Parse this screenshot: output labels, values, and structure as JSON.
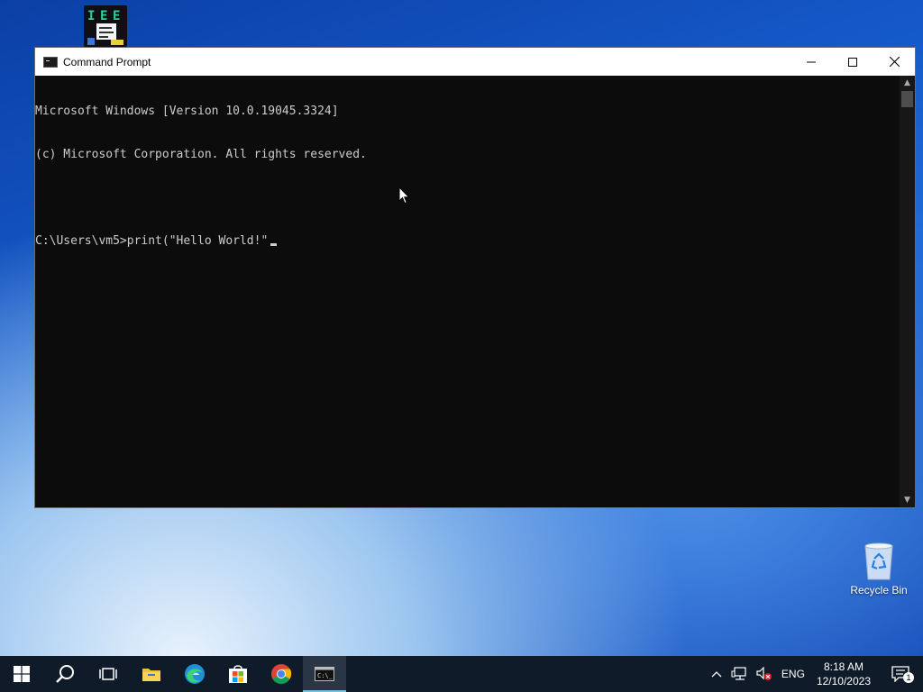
{
  "desktop": {
    "icons": [
      {
        "label": ""
      },
      {
        "label": "Recycle Bin"
      }
    ]
  },
  "window": {
    "title": "Command Prompt",
    "buttons": {
      "minimize": "minimize",
      "maximize": "maximize",
      "close": "close"
    },
    "console_lines": [
      "Microsoft Windows [Version 10.0.19045.3324]",
      "(c) Microsoft Corporation. All rights reserved.",
      "",
      "C:\\Users\\vm5>print(\"Hello World!\""
    ]
  },
  "taskbar": {
    "apps": [
      {
        "name": "start-button-icon"
      },
      {
        "name": "search-icon"
      },
      {
        "name": "task-view-icon"
      },
      {
        "name": "file-explorer-icon"
      },
      {
        "name": "edge-icon"
      },
      {
        "name": "store-icon"
      },
      {
        "name": "chrome-icon"
      },
      {
        "name": "command-prompt-icon",
        "active": true
      }
    ],
    "tray": {
      "language": "ENG",
      "time": "8:18 AM",
      "date": "12/10/2023",
      "notification_count": "1"
    }
  },
  "colors": {
    "console_bg": "#0c0c0c",
    "console_text": "#cccccc",
    "taskbar_bg": "#101b2a",
    "accent": "#76b9ed"
  }
}
